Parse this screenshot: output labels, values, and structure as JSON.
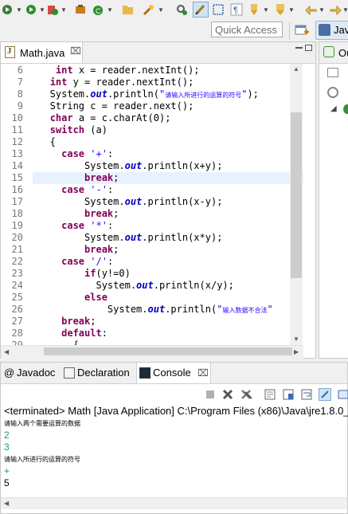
{
  "toolbar": {
    "icons": [
      "debug-icon",
      "run-icon",
      "coverage-icon",
      "external-tools-icon",
      "new-java-class-icon",
      "open-type-icon",
      "search-icon",
      "run-last-tool-icon",
      "toggle-mark-occurrences-icon",
      "toggle-block-selection-icon",
      "show-whitespace-icon",
      "next-annotation-icon",
      "last-edit-location-icon",
      "back-icon",
      "forward-icon"
    ]
  },
  "quick_access": {
    "placeholder": "Quick Access"
  },
  "perspective": {
    "label": "Jav"
  },
  "editor": {
    "tab_title": "Math.java",
    "tab_close": "⌧",
    "lines": [
      {
        "num": "6",
        "html": "    <span class='kw'>int</span> x = reader.nextInt();"
      },
      {
        "num": "7",
        "html": "   <span class='kw'>int</span> y = reader.nextInt();"
      },
      {
        "num": "8",
        "html": "   System.<span class='fld'>out</span>.println(<span class='st'>\"</span><span class='cjk'>请输入所进行的运算的符号</span><span class='st'>\"</span>);"
      },
      {
        "num": "9",
        "html": "   String c = reader.next();"
      },
      {
        "num": "10",
        "html": "   <span class='kw'>char</span> a = c.charAt(0);"
      },
      {
        "num": "11",
        "html": "   <span class='kw'>switch</span> (a)"
      },
      {
        "num": "12",
        "html": "   {"
      },
      {
        "num": "13",
        "html": "     <span class='kw'>case</span> <span class='st'>'+'</span>:"
      },
      {
        "num": "14",
        "html": "         System.<span class='fld'>out</span>.println(x+y);"
      },
      {
        "num": "15",
        "html": "         <span class='kw'>break</span>;"
      },
      {
        "num": "16",
        "html": "     <span class='kw'>case</span> <span class='st'>'-'</span>:"
      },
      {
        "num": "17",
        "html": "         System.<span class='fld'>out</span>.println(x-y);"
      },
      {
        "num": "18",
        "html": "         <span class='kw'>break</span>;"
      },
      {
        "num": "19",
        "html": "     <span class='kw'>case</span> <span class='st'>'*'</span>:"
      },
      {
        "num": "20",
        "html": "         System.<span class='fld'>out</span>.println(x*y);"
      },
      {
        "num": "21",
        "html": "         <span class='kw'>break</span>;"
      },
      {
        "num": "22",
        "html": "     <span class='kw'>case</span> <span class='st'>'/'</span>:"
      },
      {
        "num": "23",
        "html": "         <span class='kw'>if</span>(y!=0)"
      },
      {
        "num": "24",
        "html": "           System.<span class='fld'>out</span>.println(x/y);"
      },
      {
        "num": "25",
        "html": "         <span class='kw'>else</span>"
      },
      {
        "num": "26",
        "html": "             System.<span class='fld'>out</span>.println(<span class='st'>\"</span><span class='cjk'>输入数据不合法</span><span class='st'>\"</span>"
      },
      {
        "num": "27",
        "html": "     <span class='kw'>break</span>;"
      },
      {
        "num": "28",
        "html": "     <span class='kw'>default</span>:"
      },
      {
        "num": "29",
        "html": "       {"
      }
    ],
    "highlight_line": "15"
  },
  "outline": {
    "tab_label": "Ou"
  },
  "bottom_tabs": [
    {
      "label": "Javadoc",
      "icon": "javadoc-icon"
    },
    {
      "label": "Declaration",
      "icon": "declaration-icon"
    },
    {
      "label": "Console",
      "icon": "console-icon",
      "close": "⌧"
    }
  ],
  "console": {
    "status": "<terminated> Math [Java Application] C:\\Program Files (x86)\\Java\\jre1.8.0_",
    "output": [
      {
        "text": "请输入两个需要运算的数据",
        "kind": "prompt"
      },
      {
        "text": "2",
        "kind": "input"
      },
      {
        "text": "3",
        "kind": "input"
      },
      {
        "text": "请输入所进行的运算的符号",
        "kind": "prompt"
      },
      {
        "text": "+",
        "kind": "input"
      },
      {
        "text": "5",
        "kind": "result"
      }
    ]
  },
  "colors": {
    "keyword": "#7f0055",
    "string": "#2a00ff",
    "field": "#0000c0",
    "console_input": "#1c9c5c",
    "highlight": "#e8f2fe"
  }
}
